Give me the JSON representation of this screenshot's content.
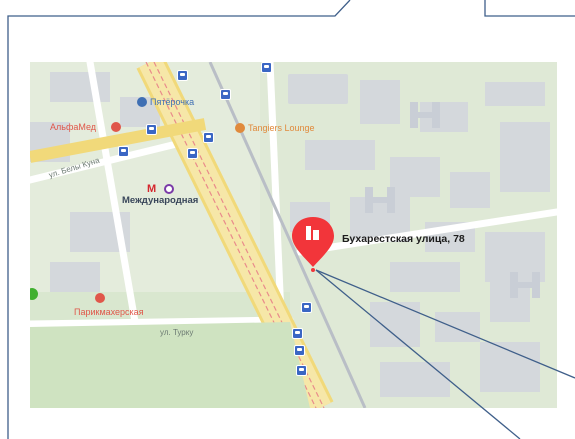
{
  "map": {
    "address_label": "Бухарестская улица, 78",
    "metro": {
      "name": "Международная",
      "icon": "metro-icon",
      "color": "#d5272e"
    },
    "places": [
      {
        "name": "АльфаМед",
        "icon": "medical-cross-icon",
        "color": "#e0574a"
      },
      {
        "name": "Пятёрочка",
        "icon": "shop-icon",
        "color": "#3f6fb3"
      },
      {
        "name": "Tangiers Lounge",
        "icon": "hookah-icon",
        "color": "#e08a3c"
      },
      {
        "name": "Парикмахерская",
        "icon": "salon-icon",
        "color": "#e0574a"
      }
    ],
    "streets": [
      {
        "name": "ул. Белы Куна"
      },
      {
        "name": "ул. Турку"
      }
    ],
    "pin": {
      "icon": "building-pin-icon",
      "color": "#f2353a"
    },
    "bus_stop_icon": "bus-stop-icon",
    "bus_stop_color": "#3a66c4"
  }
}
